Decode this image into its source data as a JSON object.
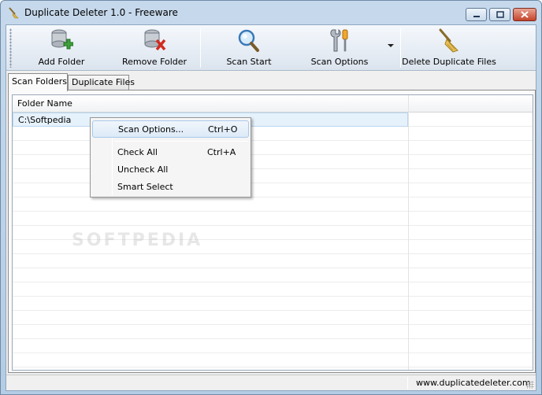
{
  "window": {
    "title": "Duplicate Deleter 1.0 - Freeware"
  },
  "toolbar": {
    "add_folder": "Add Folder",
    "remove_folder": "Remove Folder",
    "scan_start": "Scan Start",
    "scan_options": "Scan Options",
    "delete_duplicates": "Delete Duplicate Files"
  },
  "tabs": [
    {
      "label": "Scan Folders",
      "active": true
    },
    {
      "label": "Duplicate Files",
      "active": false
    }
  ],
  "grid": {
    "columns": [
      "Folder Name",
      ""
    ],
    "rows": [
      {
        "folder": "C:\\Softpedia"
      }
    ]
  },
  "context_menu": {
    "items": [
      {
        "label": "Scan Options...",
        "shortcut": "Ctrl+O"
      },
      {
        "label": "Check All",
        "shortcut": "Ctrl+A"
      },
      {
        "label": "Uncheck All",
        "shortcut": ""
      },
      {
        "label": "Smart Select",
        "shortcut": ""
      }
    ]
  },
  "status": {
    "website": "www.duplicatedeleter.com"
  },
  "watermark": "SOFTPEDIA",
  "colors": {
    "titlebar": "#c6d9ec",
    "close": "#c4432b",
    "selection": "#e6f2fb"
  }
}
